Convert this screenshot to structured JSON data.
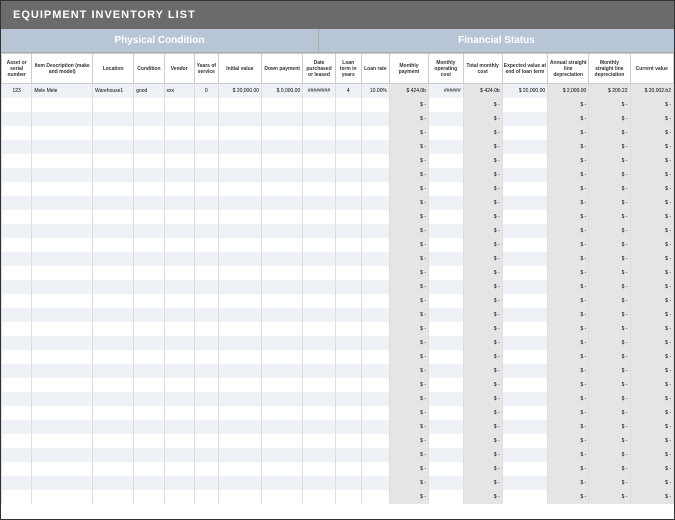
{
  "title": "EQUIPMENT INVENTORY LIST",
  "sections": {
    "physical": "Physical Condition",
    "financial": "Financial Status"
  },
  "headers": [
    "Asset or serial number",
    "Item Description (make and model)",
    "Location",
    "Condition",
    "Vendor",
    "Years of service",
    "Initial value",
    "Down payment",
    "Date purchased or leased",
    "Loan term in years",
    "Loan rate",
    "Monthly payment",
    "Monthly operating cost",
    "Total monthly cost",
    "Expected value at end of loan term",
    "Annual straight line depreciation",
    "Monthly straight line depreciation",
    "Current value"
  ],
  "row1": {
    "c0": "123",
    "c1": "Mele Mele",
    "c2": "Warehouse1",
    "c3": "good",
    "c4": "xxx",
    "c5": "0",
    "c6": "$ 20,000.00",
    "c7": "$ 0,000.00",
    "c8": "########",
    "c9": "4",
    "c10": "10.00%",
    "c11": "$ 424.0b",
    "c12": "######",
    "c13": "$ 424.0b",
    "c14": "$ 20,000.00",
    "c15": "$ 2,000.00",
    "c16": "$   200.22",
    "c17": "$ 20,002.b2"
  },
  "dash": "$        -",
  "blank": "",
  "row_count": 30,
  "shaded_cols": [
    11,
    13,
    15,
    16,
    17
  ]
}
